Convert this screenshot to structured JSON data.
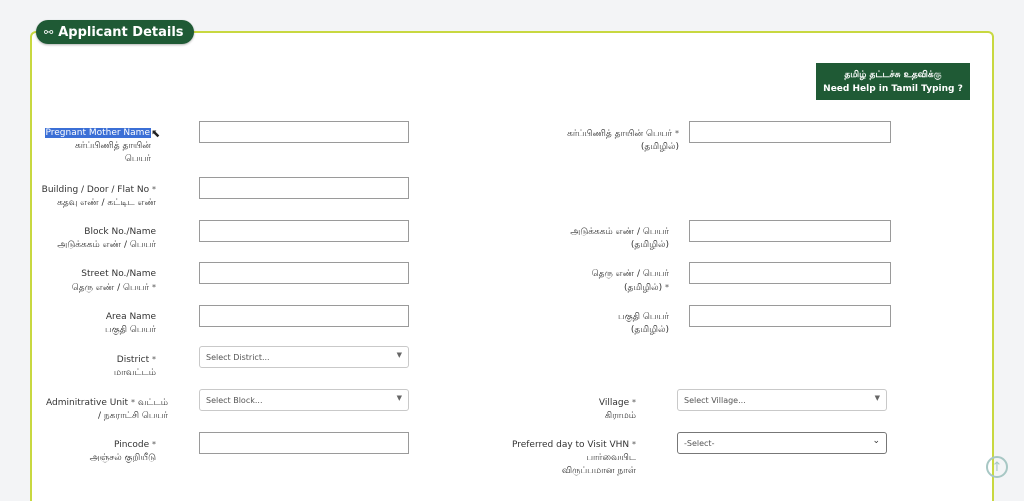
{
  "section": {
    "title": "Applicant Details",
    "icon": "share-nodes-icon"
  },
  "help": {
    "line1": "தமிழ் தட்டச்சு உதவிக்கு",
    "line2": "Need Help in Tamil Typing ?"
  },
  "required_mark": "*",
  "fields": {
    "mother_name": {
      "en": "Pregnant Mother Name",
      "ta1": "கர்ப்பிணித் தாயின்",
      "ta2": "பெயர்",
      "value": ""
    },
    "mother_name_ta": {
      "ta1": "கர்ப்பிணித் தாயின் பெயர்",
      "ta2": "(தமிழில்)",
      "value": ""
    },
    "building": {
      "en": "Building / Door / Flat No",
      "ta1": "கதவு எண் / கட்டிட எண்",
      "value": ""
    },
    "block": {
      "en": "Block No./Name",
      "ta1": "அடுக்ககம் எண் / பெயர்",
      "value": ""
    },
    "block_ta": {
      "ta1": "அடுக்ககம் எண் / பெயர்",
      "ta2": "(தமிழில்)",
      "value": ""
    },
    "street": {
      "en": "Street No./Name",
      "ta1": "தெரு எண் / பெயர்",
      "value": ""
    },
    "street_ta": {
      "ta1": "தெரு எண் / பெயர்",
      "ta2": "(தமிழில்)",
      "value": ""
    },
    "area": {
      "en": "Area Name",
      "ta1": "பகுதி பெயர்",
      "value": ""
    },
    "area_ta": {
      "ta1": "பகுதி பெயர்",
      "ta2": "(தமிழில்)",
      "value": ""
    },
    "district": {
      "en": "District",
      "ta1": "மாவட்டம்",
      "placeholder": "Select District..."
    },
    "admin_unit": {
      "en": "Adminitrative Unit",
      "ta_inline": "வட்டம்",
      "ta1": "/ நகராட்சி பெயர்",
      "placeholder": "Select Block..."
    },
    "village": {
      "en": "Village",
      "ta1": "கிராமம்",
      "placeholder": "Select Village..."
    },
    "pincode": {
      "en": "Pincode",
      "ta1": "அஞ்சல் குறியீடு",
      "value": ""
    },
    "vhn_day": {
      "en": "Preferred day to Visit VHN",
      "ta1": "பார்வையிட",
      "ta2": "விருப்பமான நாள்",
      "selected": "-Select-"
    }
  },
  "colors": {
    "brand": "#1f5a35",
    "panel_border": "#c8d840",
    "highlight": "#3b6fd6"
  }
}
